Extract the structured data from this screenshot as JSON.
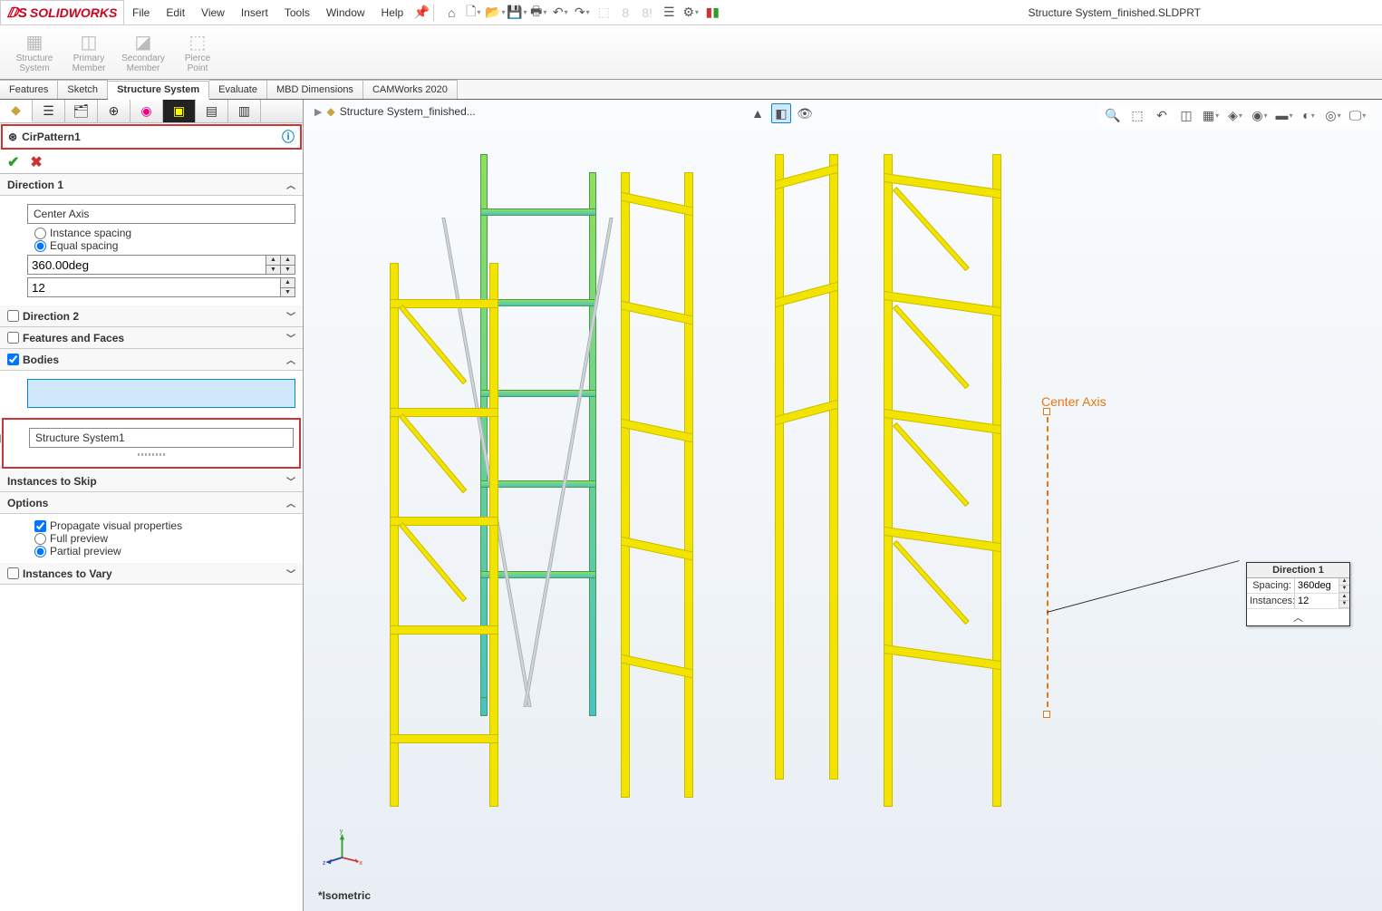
{
  "app": {
    "brand": "SOLIDWORKS",
    "title": "Structure System_finished.SLDPRT"
  },
  "menus": [
    "File",
    "Edit",
    "View",
    "Insert",
    "Tools",
    "Window",
    "Help"
  ],
  "main_toolbar_icons": [
    "home",
    "new",
    "open",
    "save",
    "print",
    "undo",
    "redo",
    "select",
    "rebuild",
    "suppress",
    "options",
    "gear",
    "compare"
  ],
  "ribbon": {
    "buttons": [
      {
        "label1": "Structure",
        "label2": "System"
      },
      {
        "label1": "Primary",
        "label2": "Member"
      },
      {
        "label1": "Secondary",
        "label2": "Member"
      },
      {
        "label1": "Pierce",
        "label2": "Point"
      }
    ]
  },
  "command_tabs": [
    "Features",
    "Sketch",
    "Structure System",
    "Evaluate",
    "MBD Dimensions",
    "CAMWorks 2020"
  ],
  "active_command_tab": "Structure System",
  "panel_tabs": [
    "feature-tree",
    "property",
    "config",
    "display",
    "appearance",
    "dimxpert",
    "render",
    "section"
  ],
  "property": {
    "title": "CirPattern1",
    "direction1": {
      "header": "Direction 1",
      "axis_selection": "Center Axis",
      "spacing_mode": {
        "instance": "Instance spacing",
        "equal": "Equal spacing",
        "selected": "equal"
      },
      "angle": "360.00deg",
      "instances": "12"
    },
    "direction2": {
      "header": "Direction 2",
      "checked": false
    },
    "features_faces": {
      "header": "Features and Faces",
      "checked": false
    },
    "bodies": {
      "header": "Bodies",
      "checked": true,
      "structure_selection": "Structure System1"
    },
    "instances_skip": {
      "header": "Instances to Skip"
    },
    "options": {
      "header": "Options",
      "propagate": {
        "label": "Propagate visual properties",
        "checked": true
      },
      "full_preview": {
        "label": "Full preview"
      },
      "partial_preview": {
        "label": "Partial preview"
      },
      "preview_mode": "partial"
    },
    "instances_vary": {
      "header": "Instances to Vary",
      "checked": false
    }
  },
  "viewport": {
    "breadcrumb": "Structure System_finished...",
    "axis_label": "Center Axis",
    "callout": {
      "title": "Direction 1",
      "spacing_label": "Spacing:",
      "spacing_value": "360deg",
      "instances_label": "Instances:",
      "instances_value": "12"
    },
    "orientation_label": "*Isometric",
    "triad": {
      "x": "x",
      "y": "y",
      "z": "z"
    }
  },
  "view_toolbar_icons": [
    "zoom-fit",
    "zoom-area",
    "prev-view",
    "section-view",
    "display-style",
    "shadows",
    "scene",
    "view-orient",
    "hide-show",
    "appearance",
    "render-tools",
    "screen"
  ],
  "orient_icons": [
    "normal-to",
    "view-cube",
    "hide-all"
  ],
  "colors": {
    "accent": "#0a84c9",
    "highlight_border": "#c33",
    "pattern_yellow": "#f2e400",
    "selected_green": "#8de05a",
    "axis_orange": "#e27815"
  }
}
